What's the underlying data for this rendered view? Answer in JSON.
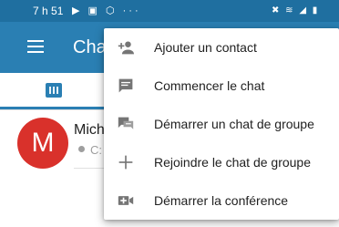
{
  "status_bar": {
    "time": "7 h 51",
    "left_icons": "▶ ▣ ⬡ ···",
    "right_icons": "✖ ≋ ◢ ▮"
  },
  "app_bar": {
    "title": "Chat"
  },
  "tabs": {
    "chats_icon": "chat-tab-icon"
  },
  "chat_list": [
    {
      "avatar_initial": "M",
      "avatar_color": "#d9312b",
      "name": "Mich",
      "status": "C:"
    }
  ],
  "menu": {
    "items": [
      {
        "label": "Ajouter un contact",
        "icon": "add-contact-icon"
      },
      {
        "label": "Commencer le chat",
        "icon": "chat-icon"
      },
      {
        "label": "Démarrer un chat de groupe",
        "icon": "group-chat-icon"
      },
      {
        "label": "Rejoindre le chat de groupe",
        "icon": "plus-icon"
      },
      {
        "label": "Démarrer la conférence",
        "icon": "video-icon"
      }
    ]
  },
  "colors": {
    "status_bar": "#1f6fa0",
    "app_bar": "#2a7fb3",
    "accent": "#2a7fb3",
    "icon_gray": "#757575"
  }
}
